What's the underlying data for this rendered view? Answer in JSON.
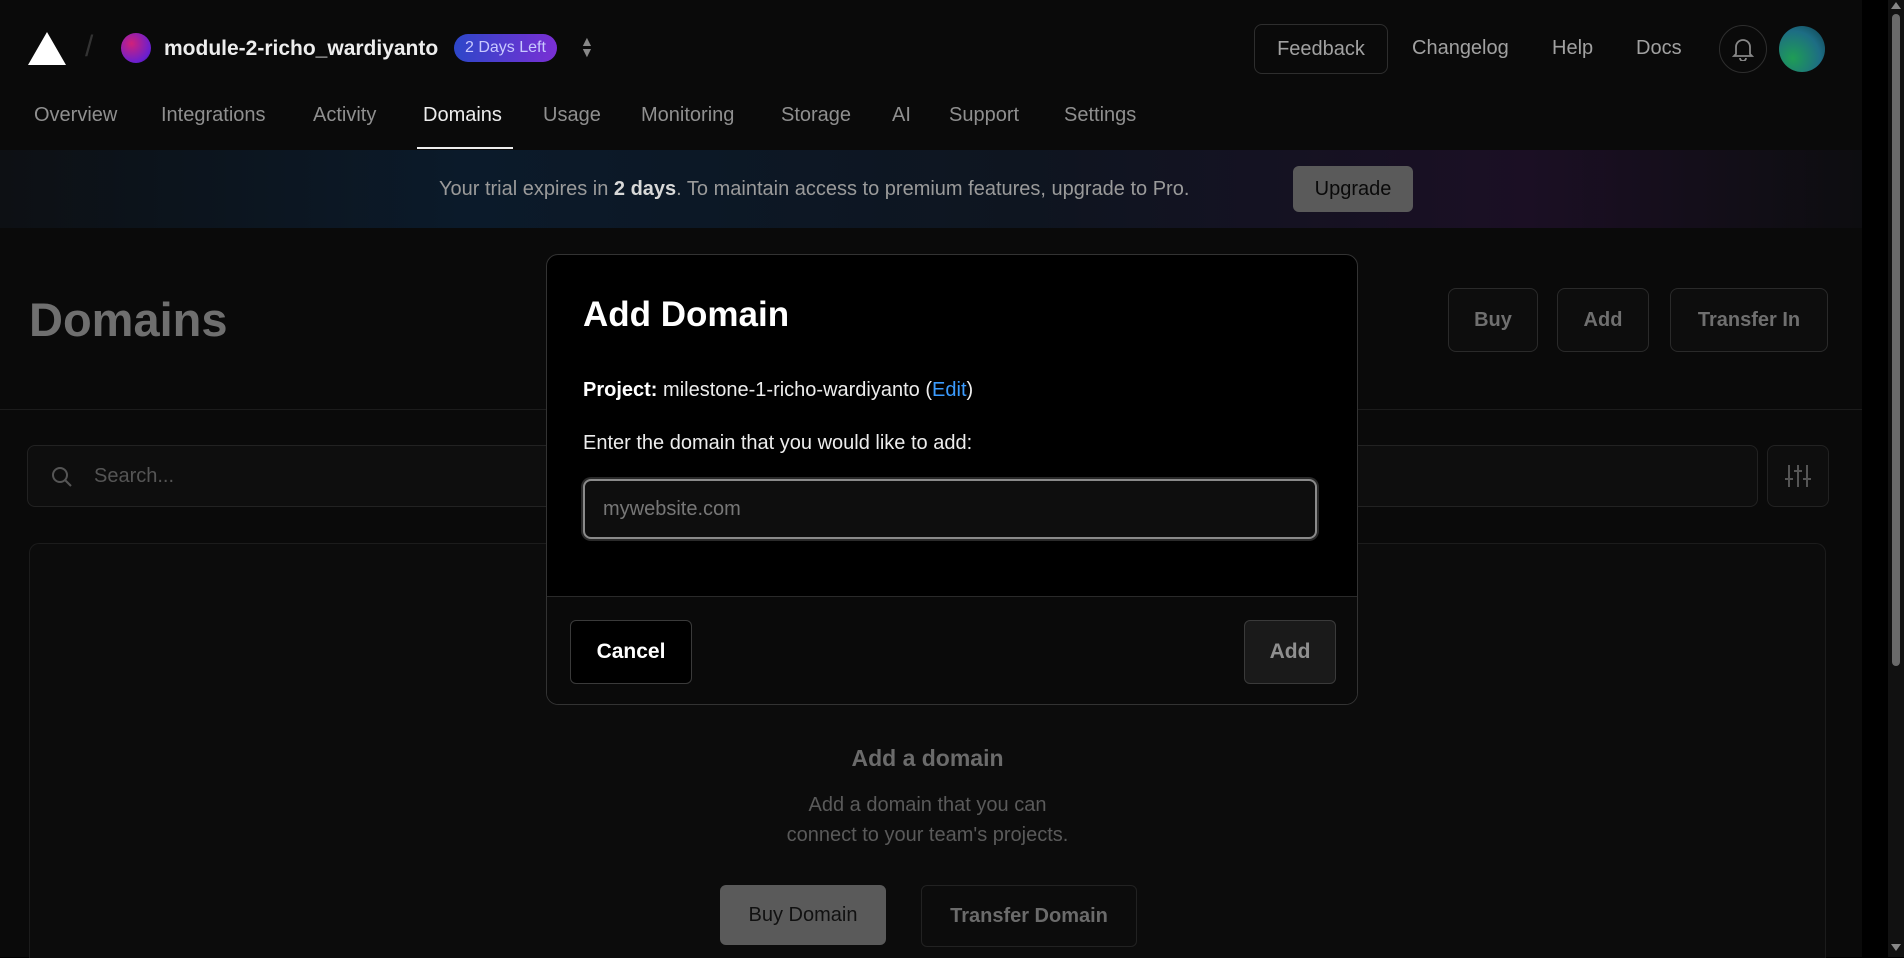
{
  "header": {
    "team_name": "module-2-richo_wardiyanto",
    "trial_badge": "2 Days Left",
    "feedback": "Feedback",
    "links": [
      "Changelog",
      "Help",
      "Docs"
    ]
  },
  "tabs": [
    "Overview",
    "Integrations",
    "Activity",
    "Domains",
    "Usage",
    "Monitoring",
    "Storage",
    "AI",
    "Support",
    "Settings"
  ],
  "active_tab": "Domains",
  "trial_banner": {
    "prefix": "Your trial expires in ",
    "highlight": "2 days",
    "suffix": ". To maintain access to premium features, upgrade to Pro.",
    "upgrade": "Upgrade"
  },
  "page": {
    "title": "Domains",
    "buttons": [
      "Buy",
      "Add",
      "Transfer In"
    ],
    "search_placeholder": "Search..."
  },
  "empty_state": {
    "title": "Add a domain",
    "desc_line1": "Add a domain that you can",
    "desc_line2": "connect to your team's projects.",
    "buy_domain": "Buy Domain",
    "transfer_domain": "Transfer Domain"
  },
  "modal": {
    "title": "Add Domain",
    "project_label": "Project:",
    "project_name": "milestone-1-richo-wardiyanto",
    "edit": "Edit",
    "prompt": "Enter the domain that you would like to add:",
    "input_placeholder": "mywebsite.com",
    "input_value": "",
    "cancel": "Cancel",
    "add": "Add"
  },
  "colors": {
    "link": "#3b9cff",
    "badge_start": "#2d47c9",
    "badge_end": "#7a2fd4"
  }
}
